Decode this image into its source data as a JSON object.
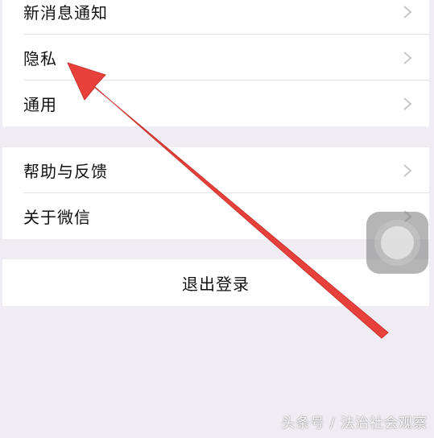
{
  "settings": {
    "group1": [
      {
        "label": "新消息通知",
        "icon": "chevron-right-icon"
      },
      {
        "label": "隐私",
        "icon": "chevron-right-icon"
      },
      {
        "label": "通用",
        "icon": "chevron-right-icon"
      }
    ],
    "group2": [
      {
        "label": "帮助与反馈",
        "icon": "chevron-right-icon"
      },
      {
        "label": "关于微信",
        "icon": "chevron-right-icon"
      }
    ],
    "logout_label": "退出登录"
  },
  "annotation": {
    "color": "#e8403a",
    "points_to": "隐私"
  },
  "overlay": {
    "icon": "assistive-touch-icon"
  },
  "watermark": "头条号 / 法治社会观察",
  "colors": {
    "background": "#efedf3",
    "cell": "#ffffff",
    "separator": "#e3e3e6",
    "chevron": "#c7c7cc"
  }
}
